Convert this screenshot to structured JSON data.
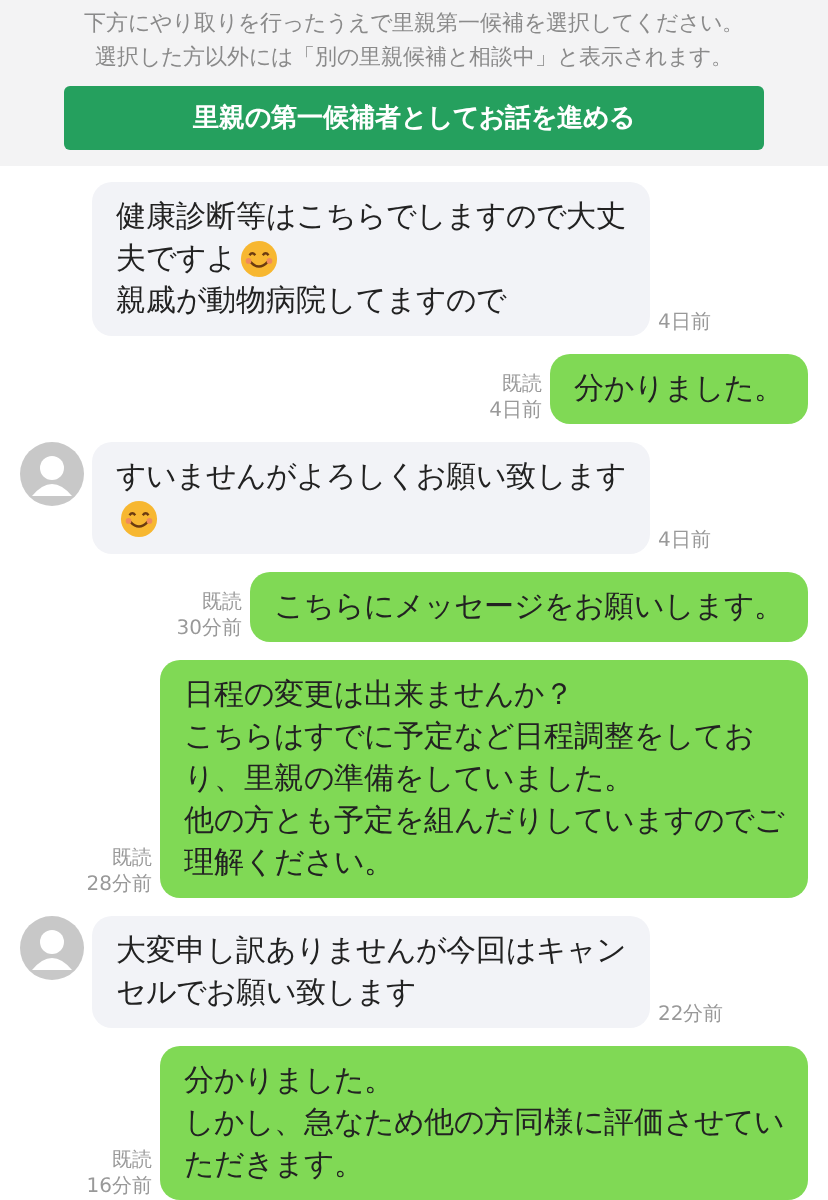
{
  "banner": {
    "notes": [
      "下方にやり取りを行ったうえで里親第一候補を選択してください。",
      "選択した方以外には「別の里親候補と相談中」と表示されます。"
    ],
    "button": "里親の第一候補者としてお話を進める"
  },
  "messages": [
    {
      "kind": "incoming",
      "avatar": false,
      "lines": [
        {
          "text": "健康診断等はこちらでしますので大丈",
          "emoji": false
        },
        {
          "text": "夫ですよ",
          "emoji": true
        },
        {
          "text": "親戚が動物病院してますので",
          "emoji": false
        }
      ],
      "time": "4日前"
    },
    {
      "kind": "outgoing",
      "lines": [
        {
          "text": "分かりました。",
          "emoji": false
        }
      ],
      "read": "既読",
      "time": "4日前"
    },
    {
      "kind": "incoming",
      "avatar": true,
      "lines": [
        {
          "text": "すいませんがよろしくお願い致します",
          "emoji": false
        },
        {
          "emoji": true
        }
      ],
      "time": "4日前"
    },
    {
      "kind": "outgoing",
      "lines": [
        {
          "text": "こちらにメッセージをお願いします。",
          "emoji": false
        }
      ],
      "read": "既読",
      "time": "30分前"
    },
    {
      "kind": "outgoing",
      "lines": [
        {
          "text": "日程の変更は出来ませんか？",
          "emoji": false
        },
        {
          "text": "こちらはすでに予定など日程調整をしてお",
          "emoji": false
        },
        {
          "text": "り、里親の準備をしていました。",
          "emoji": false
        },
        {
          "text": "他の方とも予定を組んだりしていますのでご",
          "emoji": false
        },
        {
          "text": "理解ください。",
          "emoji": false
        }
      ],
      "read": "既読",
      "time": "28分前"
    },
    {
      "kind": "incoming",
      "avatar": true,
      "lines": [
        {
          "text": "大変申し訳ありませんが今回はキャン",
          "emoji": false
        },
        {
          "text": "セルでお願い致します",
          "emoji": false
        }
      ],
      "time": "22分前"
    },
    {
      "kind": "outgoing",
      "lines": [
        {
          "text": "分かりました。",
          "emoji": false
        },
        {
          "text": "しかし、急なため他の方同様に評価させてい",
          "emoji": false
        },
        {
          "text": "ただきます。",
          "emoji": false
        }
      ],
      "read": "既読",
      "time": "16分前"
    }
  ]
}
